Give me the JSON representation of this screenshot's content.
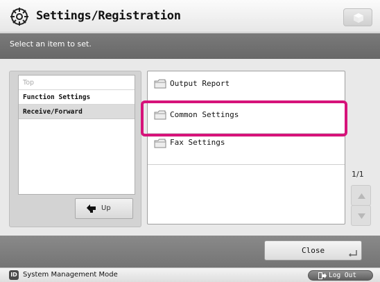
{
  "header": {
    "title": "Settings/Registration",
    "title_icon": "settings-gear-icon",
    "corner_button_icon": "cube-icon"
  },
  "instruction": "Select an item to set.",
  "breadcrumb": {
    "items": [
      "Top",
      "Function Settings",
      "Receive/Forward"
    ],
    "selected_index": 2
  },
  "up_button": {
    "label": "Up",
    "icon": "up-arrow-icon"
  },
  "settings_list": {
    "items": [
      {
        "label": "Output Report",
        "icon": "folder-icon"
      },
      {
        "label": "Common Settings",
        "icon": "folder-icon",
        "highlighted": true
      },
      {
        "label": "Fax Settings",
        "icon": "folder-icon"
      }
    ]
  },
  "pager": {
    "text": "1/1"
  },
  "footer": {
    "close_label": "Close"
  },
  "status": {
    "id_badge": "ID",
    "mode_label": "System Management Mode",
    "logout_label": "Log Out"
  },
  "colors": {
    "highlight": "#d6137a",
    "instruction_band": "#707070"
  }
}
